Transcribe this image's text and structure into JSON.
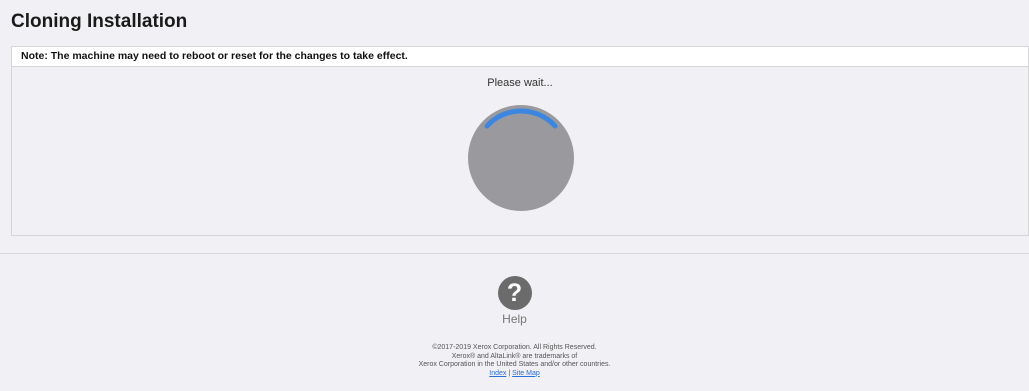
{
  "page": {
    "title": "Cloning Installation"
  },
  "panel": {
    "note": "Note: The machine may need to reboot or reset for the changes to take effect.",
    "wait_text": "Please wait..."
  },
  "colors": {
    "spinner_arc": "#3b86e0",
    "spinner_disc": "#9a9a9e",
    "help_icon": "#6b6b6b",
    "link": "#2a6fd6"
  },
  "help": {
    "icon": "question-circle-icon",
    "glyph": "?",
    "label": "Help"
  },
  "footer": {
    "copyright": "©2017-2019 Xerox Corporation. All Rights Reserved.",
    "trademark_1": "Xerox® and AltaLink® are trademarks of",
    "trademark_2": "Xerox Corporation in the United States and/or other countries.",
    "link_index": "Index",
    "separator": "|",
    "link_sitemap": "Site Map"
  }
}
